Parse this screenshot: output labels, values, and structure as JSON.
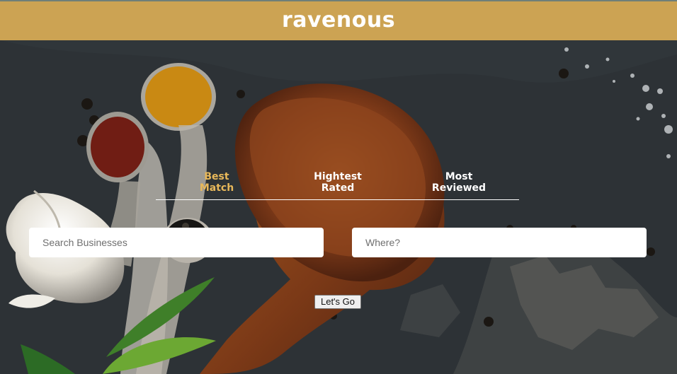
{
  "header": {
    "title": "ravenous"
  },
  "sort_options": [
    {
      "label_line_1": "Best",
      "label_line_2": "Match",
      "state": "selected"
    },
    {
      "label_line_1": "Hightest",
      "label_line_2": "Rated",
      "state": "unselected"
    },
    {
      "label_line_1": "Most",
      "label_line_2": "Reviewed",
      "state": "unselected"
    }
  ],
  "search": {
    "business_placeholder": "Search Businesses",
    "location_placeholder": "Where?",
    "submit_label": "Let's Go"
  },
  "colors": {
    "header_background": "#cca353",
    "active_tab": "#e8b85a",
    "inactive_tab": "#ffffff"
  }
}
